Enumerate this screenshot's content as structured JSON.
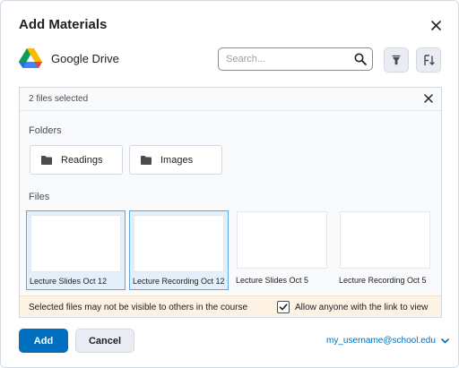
{
  "dialog": {
    "title": "Add Materials"
  },
  "provider": {
    "name": "Google Drive",
    "icon": "google-drive-icon"
  },
  "search": {
    "placeholder": "Search..."
  },
  "toolbar": {
    "filter_icon": "filter-icon",
    "sort_icon": "sort-icon"
  },
  "selection": {
    "text": "2 files selected"
  },
  "folders": {
    "label": "Folders",
    "items": [
      {
        "label": "Readings",
        "icon": "folder-icon"
      },
      {
        "label": "Images",
        "icon": "folder-icon"
      }
    ]
  },
  "files": {
    "label": "Files",
    "items": [
      {
        "label": "Lecture Slides Oct 12",
        "selected": true
      },
      {
        "label": "Lecture Recording Oct 12",
        "selected": true
      },
      {
        "label": "Lecture Slides Oct 5",
        "selected": false
      },
      {
        "label": "Lecture Recording Oct 5",
        "selected": false
      }
    ]
  },
  "warning": {
    "text": "Selected files may not be visible to others in the course",
    "checkbox_label": "Allow anyone with the link to view",
    "checked": true
  },
  "footer": {
    "add_label": "Add",
    "cancel_label": "Cancel",
    "account": "my_username@school.edu"
  },
  "colors": {
    "primary": "#006fbf",
    "selected_border": "#5aa9e6",
    "warning_bg": "#fdf2e3"
  }
}
